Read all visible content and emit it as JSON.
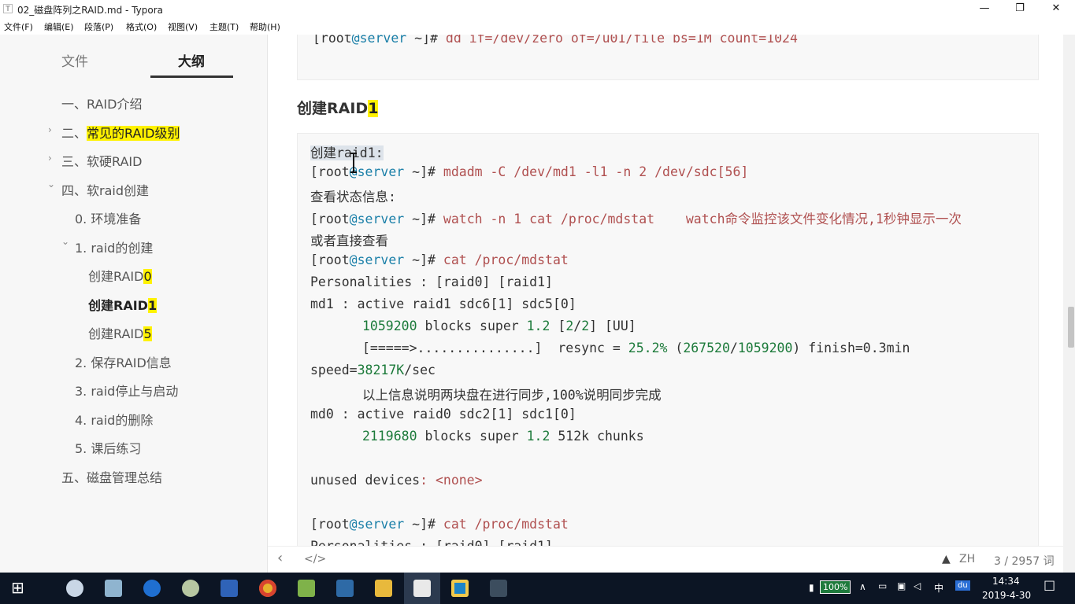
{
  "window": {
    "icon_letter": "T",
    "title": "02_磁盘阵列之RAID.md - Typora",
    "minimize": "—",
    "maximize": "❐",
    "close": "✕"
  },
  "menu": [
    "文件(F)",
    "编辑(E)",
    "段落(P)",
    "格式(O)",
    "视图(V)",
    "主题(T)",
    "帮助(H)"
  ],
  "sidebar": {
    "tabs": [
      "文件",
      "大纲"
    ],
    "outline": [
      {
        "text": "一、RAID介绍",
        "hl": ""
      },
      {
        "text": "二、",
        "hl": "常见的RAID级别"
      },
      {
        "text": "三、软硬RAID",
        "hl": ""
      },
      {
        "text": "四、软raid创建",
        "hl": ""
      },
      {
        "text": "0. 环境准备",
        "hl": ""
      },
      {
        "text": "1. raid的创建",
        "hl": ""
      },
      {
        "text": "创建RAID",
        "hl": "0"
      },
      {
        "text": "创建RAID",
        "hl": "1"
      },
      {
        "text": "创建RAID",
        "hl": "5"
      },
      {
        "text": "2. 保存RAID信息",
        "hl": ""
      },
      {
        "text": "3. raid停止与启动",
        "hl": ""
      },
      {
        "text": "4. raid的删除",
        "hl": ""
      },
      {
        "text": "5. 课后练习",
        "hl": ""
      },
      {
        "text": "五、磁盘管理总结",
        "hl": ""
      }
    ],
    "chevrons": {
      "collapsed": "›",
      "expanded": "⌄"
    }
  },
  "editor": {
    "top_block": {
      "prompt_a": "[root",
      "prompt_at": "@server",
      "prompt_b": " ~]# ",
      "cmd": "dd if=/dev/zero of=/u01/file bs=1M count=1024"
    },
    "heading": {
      "text": "创建RAID",
      "hl": "1"
    },
    "block": {
      "l1": "创建raid1:",
      "prompt_a": "[root",
      "prompt_at": "@server",
      "prompt_b": " ~]# ",
      "l2_cmd": "mdadm -C /dev/md1 -l1 -n 2 /dev/sdc[56]",
      "l3": "查看状态信息:",
      "l4_cmd": "watch -n 1 cat /proc/mdstat    watch命令监控该文件变化情况,1秒钟显示一次",
      "l5": "或者直接查看",
      "l6_cmd": "cat /proc/mdstat",
      "l7": "Personalities : [raid0] [raid1]",
      "l8": "md1 : active raid1 sdc6[1] sdc5[0]",
      "l9_num": "1059200",
      "l9_mid": " blocks super ",
      "l9_v": "1.2",
      "l9_a": " [",
      "l9_b": "2",
      "l9_c": "/",
      "l9_d": "2",
      "l9_e": "] [UU]",
      "l10_a": "[=====>...............]  resync = ",
      "l10_pct": "25.2%",
      "l10_b": " (",
      "l10_n1": "267520",
      "l10_slash": "/",
      "l10_n2": "1059200",
      "l10_c": ") finish=0.3min",
      "l11_a": "speed=",
      "l11_n": "38217K",
      "l11_b": "/sec",
      "l12": "以上信息说明两块盘在进行同步,100%说明同步完成",
      "l13": "md0 : active raid0 sdc2[1] sdc1[0]",
      "l14_num": "2119680",
      "l14_mid": " blocks super ",
      "l14_v": "1.2",
      "l14_e": " 512k chunks",
      "l16_a": "unused devices",
      "l16_b": ": <none>",
      "l18_cmd": "cat /proc/mdstat",
      "l19": "Personalities : [raid0] [raid1]"
    }
  },
  "statusbar": {
    "back": "‹",
    "source": "</>",
    "warn": "▲",
    "lang": "ZH",
    "count": "3 / 2957 词"
  },
  "taskbar": {
    "start": "⊞",
    "battery": "100%",
    "tray_up": "∧",
    "ime": "中",
    "du": "du",
    "time": "14:34",
    "date": "2019-4-30",
    "notify": "☐"
  },
  "colors": {
    "highlight": "#fff200",
    "taskbar": "#0c1524",
    "prompt_at": "#1a7fa8",
    "command": "#b05050",
    "note": "#c0392b",
    "number": "#1c7a3a"
  }
}
